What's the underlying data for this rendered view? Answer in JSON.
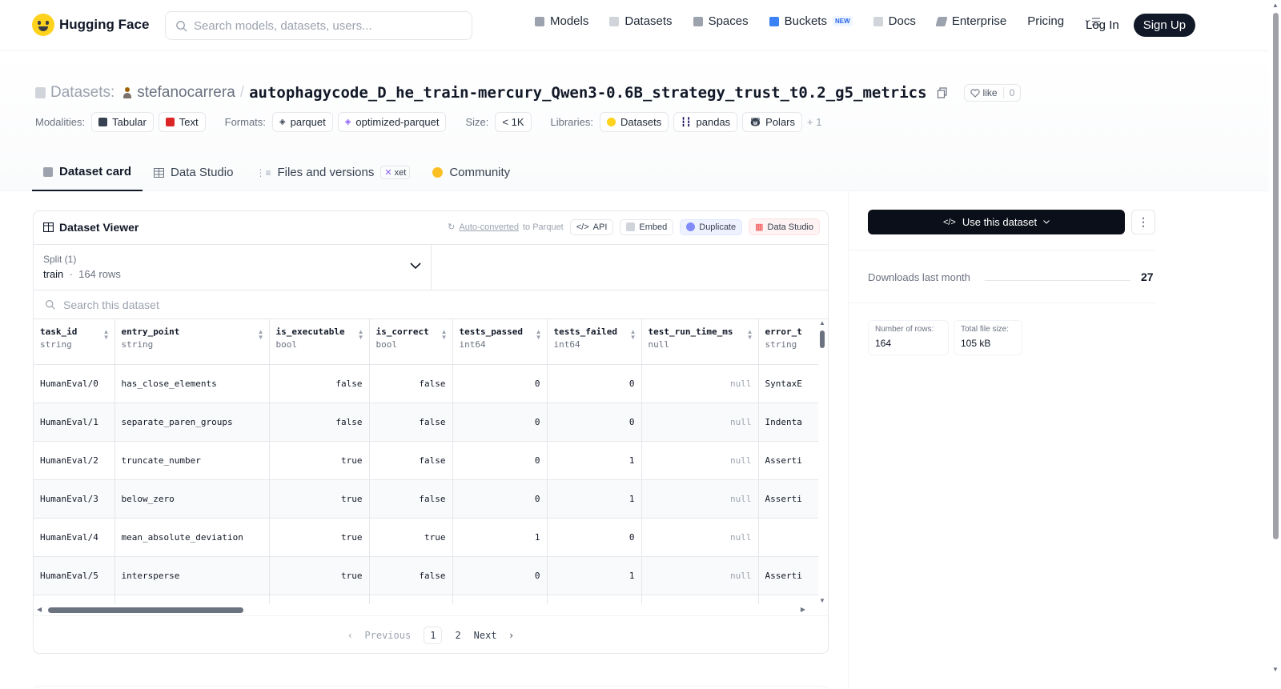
{
  "nav": {
    "logo_text": "Hugging Face",
    "search_placeholder": "Search models, datasets, users...",
    "items": [
      {
        "label": "Models",
        "icon": "models-icon",
        "color": "#9ca3af"
      },
      {
        "label": "Datasets",
        "icon": "datasets-icon",
        "color": "#d1d5db"
      },
      {
        "label": "Spaces",
        "icon": "spaces-icon",
        "color": "#9ca3af"
      },
      {
        "label": "Buckets",
        "icon": "buckets-icon",
        "color": "#3b82f6"
      },
      {
        "label": "Docs",
        "icon": "docs-icon",
        "color": "#d1d5db"
      },
      {
        "label": "Enterprise",
        "icon": "enterprise-icon",
        "color": "#9ca3af"
      },
      {
        "label": "Pricing"
      }
    ],
    "new_badge": "NEW",
    "login": "Log In",
    "signup": "Sign Up"
  },
  "header": {
    "prefix": "Datasets:",
    "owner": "stefanocarrera",
    "separator": "/",
    "name": "autophagycode_D_he_train-mercury_Qwen3-0.6B_strategy_trust_t0.2_g5_metrics",
    "like_label": "like",
    "like_count": "0",
    "modalities_label": "Modalities:",
    "modalities": [
      "Tabular",
      "Text"
    ],
    "formats_label": "Formats:",
    "formats": [
      "parquet",
      "optimized-parquet"
    ],
    "size_label": "Size:",
    "size": "< 1K",
    "libraries_label": "Libraries:",
    "libraries": [
      "Datasets",
      "pandas",
      "Polars"
    ],
    "libraries_more": "+ 1"
  },
  "tabs": [
    {
      "label": "Dataset card",
      "active": true
    },
    {
      "label": "Data Studio"
    },
    {
      "label": "Files and versions",
      "badge": "xet"
    },
    {
      "label": "Community"
    }
  ],
  "viewer": {
    "title": "Dataset Viewer",
    "auto_converted": "Auto-converted",
    "to_parquet": "to Parquet",
    "actions": [
      "API",
      "Embed",
      "Duplicate",
      "Data Studio"
    ],
    "split_label": "Split (1)",
    "split_name": "train",
    "split_rows": "164 rows",
    "search_placeholder": "Search this dataset",
    "columns": [
      {
        "name": "task_id",
        "type": "string"
      },
      {
        "name": "entry_point",
        "type": "string"
      },
      {
        "name": "is_executable",
        "type": "bool"
      },
      {
        "name": "is_correct",
        "type": "bool"
      },
      {
        "name": "tests_passed",
        "type": "int64"
      },
      {
        "name": "tests_failed",
        "type": "int64"
      },
      {
        "name": "test_run_time_ms",
        "type": "null"
      },
      {
        "name": "error_t",
        "type": "string"
      }
    ],
    "rows": [
      [
        "HumanEval/0",
        "has_close_elements",
        "false",
        "false",
        "0",
        "0",
        "null",
        "SyntaxE"
      ],
      [
        "HumanEval/1",
        "separate_paren_groups",
        "false",
        "false",
        "0",
        "0",
        "null",
        "Indenta"
      ],
      [
        "HumanEval/2",
        "truncate_number",
        "true",
        "false",
        "0",
        "1",
        "null",
        "Asserti"
      ],
      [
        "HumanEval/3",
        "below_zero",
        "true",
        "false",
        "0",
        "1",
        "null",
        "Asserti"
      ],
      [
        "HumanEval/4",
        "mean_absolute_deviation",
        "true",
        "true",
        "1",
        "0",
        "null",
        ""
      ],
      [
        "HumanEval/5",
        "intersperse",
        "true",
        "false",
        "0",
        "1",
        "null",
        "Asserti"
      ]
    ],
    "pager": {
      "prev": "Previous",
      "pages": [
        "1",
        "2"
      ],
      "next": "Next"
    }
  },
  "sidebar": {
    "use_button": "Use this dataset",
    "downloads_label": "Downloads last month",
    "downloads_value": "27",
    "rows_label": "Number of rows:",
    "rows_value": "164",
    "size_label": "Total file size:",
    "size_value": "105 kB"
  }
}
